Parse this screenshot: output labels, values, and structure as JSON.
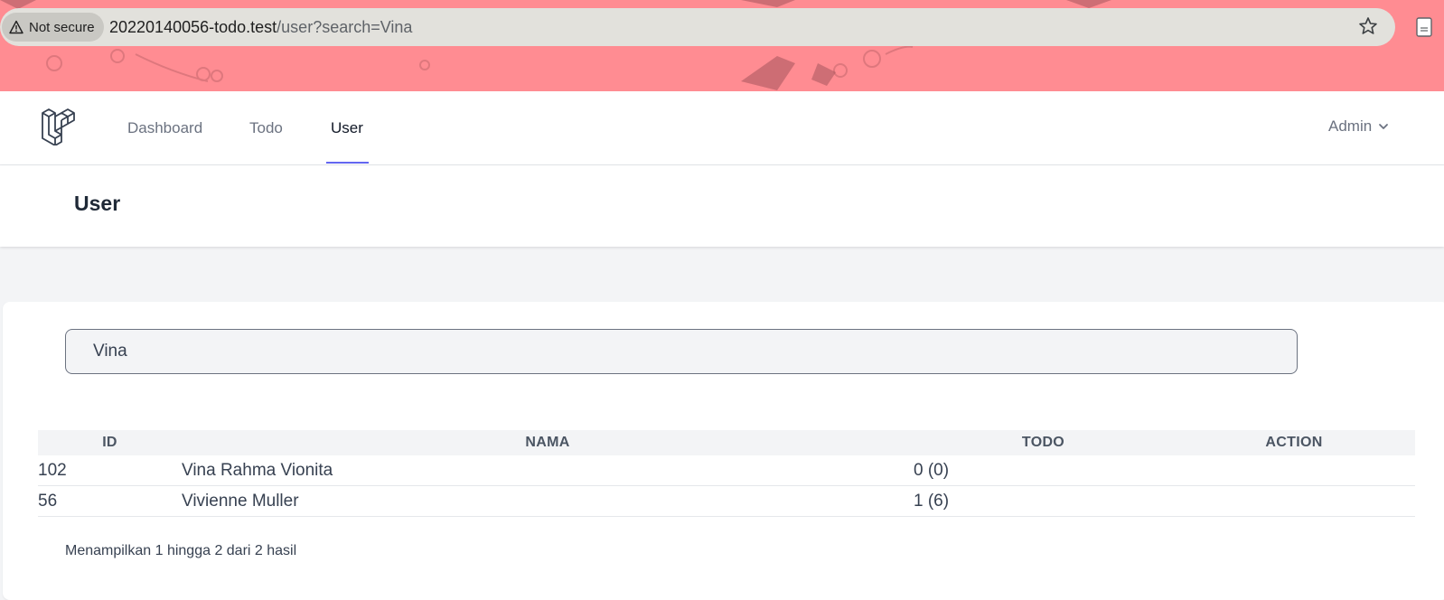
{
  "browser": {
    "security_label": "Not secure",
    "url_host": "20220140056-todo.test",
    "url_path": "/user?search=Vina",
    "bookmark_icon": "star-icon",
    "theme_color": "#ff8c92"
  },
  "nav": {
    "links": [
      {
        "label": "Dashboard"
      },
      {
        "label": "Todo"
      },
      {
        "label": "User"
      }
    ],
    "active_link": "User",
    "user_menu_label": "Admin",
    "accent_color": "#6366f1"
  },
  "header": {
    "title": "User"
  },
  "search": {
    "value": "Vina"
  },
  "table": {
    "columns": [
      "ID",
      "NAMA",
      "TODO",
      "ACTION"
    ],
    "rows": [
      {
        "id": "102",
        "nama": "Vina Rahma Vionita",
        "todo": "0 (0)",
        "action": ""
      },
      {
        "id": "56",
        "nama": "Vivienne Muller",
        "todo": "1 (6)",
        "action": ""
      }
    ]
  },
  "pagination": {
    "summary": "Menampilkan 1 hingga 2 dari 2 hasil"
  }
}
